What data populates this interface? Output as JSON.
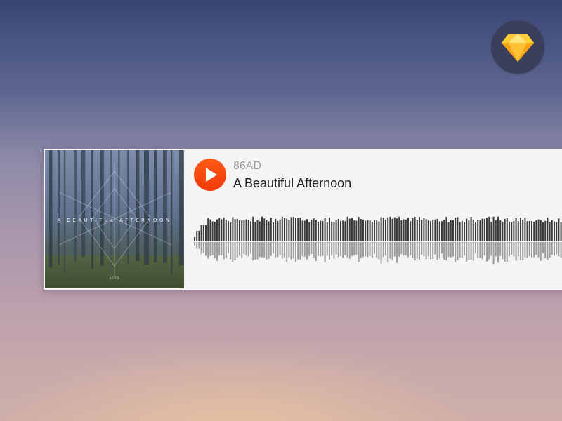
{
  "player": {
    "artist": "86AD",
    "title": "A Beautiful Afternoon",
    "artwork": {
      "title": "A BEAUTIFUL AFTERNOON",
      "artist": "86AD"
    },
    "play_icon": "play-icon",
    "waveform_icon": "waveform"
  },
  "badge": {
    "icon": "sketch-diamond-icon",
    "colors": {
      "background": "#3b3f5b",
      "gem_top": "#fdd231",
      "gem_bottom": "#f7a916"
    }
  },
  "colors": {
    "accent": "#f4470c",
    "card": "#f4f4f4",
    "wave_top": "#3a3a3a",
    "wave_bottom": "#9c9c9c"
  }
}
